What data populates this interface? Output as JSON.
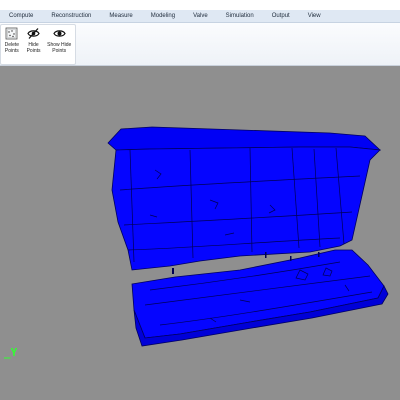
{
  "menu": {
    "items": [
      "Compute",
      "Reconstruction",
      "Measure",
      "Modeling",
      "Valve",
      "Simulation",
      "Output",
      "View"
    ]
  },
  "ribbon": {
    "delete_points": {
      "line1": "Delete",
      "line2": "Points",
      "icon": "delete-points-icon"
    },
    "hide_points": {
      "line1": "Hide",
      "line2": "Points",
      "icon": "eye-slash-icon"
    },
    "show_hide_points": {
      "line1": "Show Hide",
      "line2": "Points",
      "icon": "eye-icon"
    }
  },
  "viewport": {
    "background_color": "#8f8f8f",
    "mesh_color": "#0000ff",
    "axis_label": "Y",
    "axis_color": "#30ff30"
  }
}
